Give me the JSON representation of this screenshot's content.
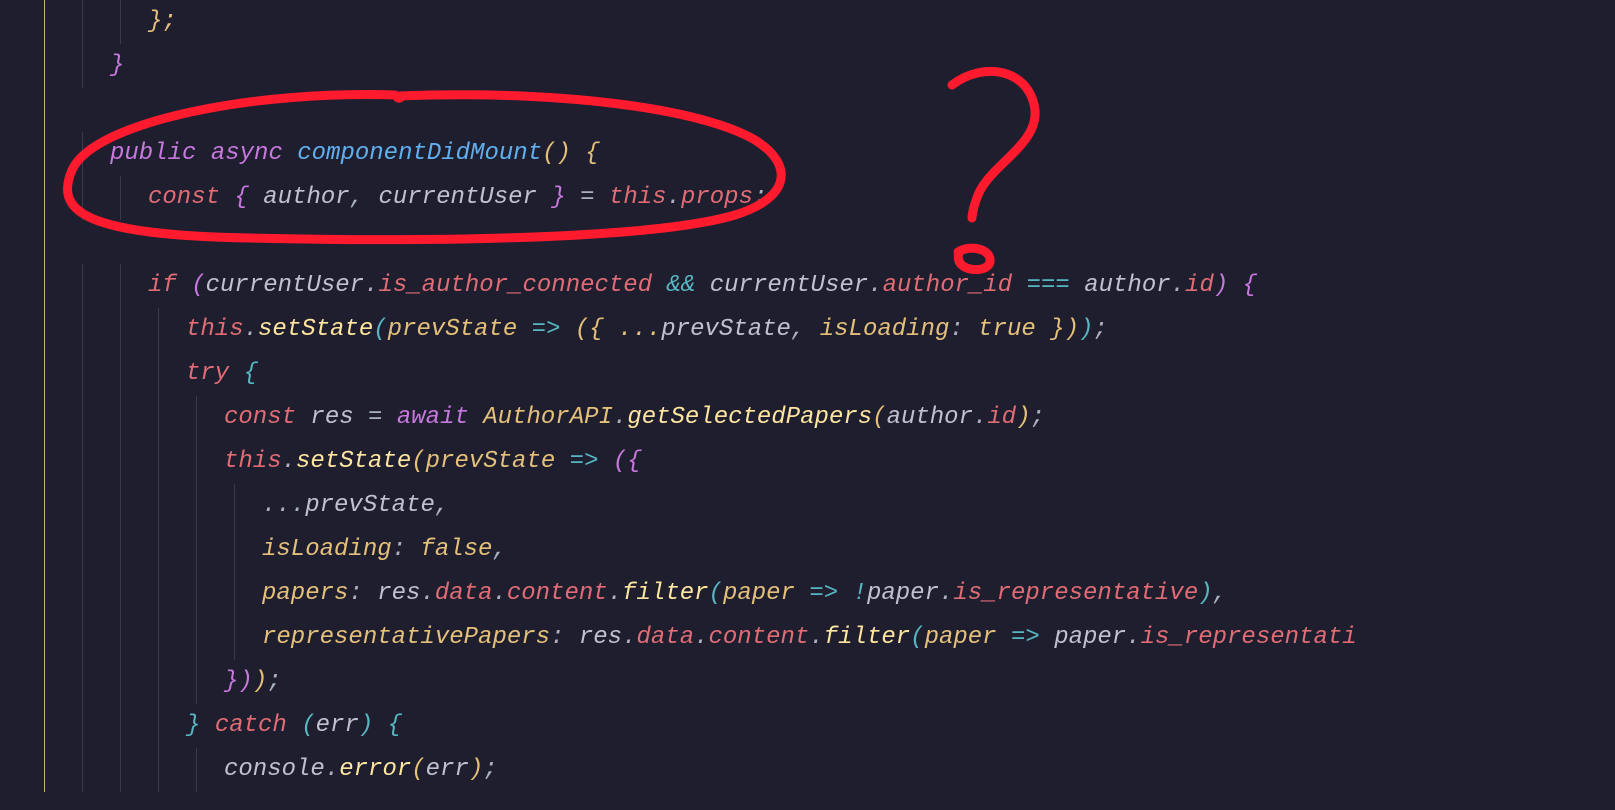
{
  "lines": [
    {
      "indent": 2,
      "tokens": [
        {
          "t": "};",
          "c": "brace-y"
        }
      ]
    },
    {
      "indent": 1,
      "tokens": [
        {
          "t": "}",
          "c": "brace-p"
        }
      ]
    },
    {
      "indent": 0,
      "tokens": []
    },
    {
      "indent": 1,
      "tokens": [
        {
          "t": "public ",
          "c": "kw-public"
        },
        {
          "t": "async ",
          "c": "kw-async"
        },
        {
          "t": "componentDidMount",
          "c": "fn"
        },
        {
          "t": "() {",
          "c": "brace-y"
        }
      ]
    },
    {
      "indent": 2,
      "tokens": [
        {
          "t": "const ",
          "c": "kw-const"
        },
        {
          "t": "{ ",
          "c": "brace-p"
        },
        {
          "t": "author",
          "c": "var"
        },
        {
          "t": ", ",
          "c": "punct"
        },
        {
          "t": "currentUser",
          "c": "var"
        },
        {
          "t": " } ",
          "c": "brace-p"
        },
        {
          "t": "= ",
          "c": "eq"
        },
        {
          "t": "this",
          "c": "kw-this"
        },
        {
          "t": ".",
          "c": "punct"
        },
        {
          "t": "props",
          "c": "prop2"
        },
        {
          "t": ";",
          "c": "punct"
        }
      ]
    },
    {
      "indent": 0,
      "tokens": []
    },
    {
      "indent": 2,
      "tokens": [
        {
          "t": "if ",
          "c": "kw-if"
        },
        {
          "t": "(",
          "c": "brace-p"
        },
        {
          "t": "currentUser",
          "c": "var"
        },
        {
          "t": ".",
          "c": "punct"
        },
        {
          "t": "is_author_connected",
          "c": "prop2"
        },
        {
          "t": " && ",
          "c": "op"
        },
        {
          "t": "currentUser",
          "c": "var"
        },
        {
          "t": ".",
          "c": "punct"
        },
        {
          "t": "author_id",
          "c": "prop2"
        },
        {
          "t": " === ",
          "c": "op"
        },
        {
          "t": "author",
          "c": "var"
        },
        {
          "t": ".",
          "c": "punct"
        },
        {
          "t": "id",
          "c": "prop2"
        },
        {
          "t": ") {",
          "c": "brace-p"
        }
      ]
    },
    {
      "indent": 3,
      "tokens": [
        {
          "t": "this",
          "c": "kw-this"
        },
        {
          "t": ".",
          "c": "punct"
        },
        {
          "t": "setState",
          "c": "method"
        },
        {
          "t": "(",
          "c": "brace-b"
        },
        {
          "t": "prevState",
          "c": "param"
        },
        {
          "t": " => ",
          "c": "op"
        },
        {
          "t": "({ ...",
          "c": "brace-y"
        },
        {
          "t": "prevState",
          "c": "var"
        },
        {
          "t": ", ",
          "c": "punct"
        },
        {
          "t": "isLoading",
          "c": "param"
        },
        {
          "t": ": ",
          "c": "punct"
        },
        {
          "t": "true",
          "c": "kw-true"
        },
        {
          "t": " })",
          "c": "brace-y"
        },
        {
          "t": ")",
          "c": "brace-b"
        },
        {
          "t": ";",
          "c": "punct"
        }
      ]
    },
    {
      "indent": 3,
      "tokens": [
        {
          "t": "try ",
          "c": "kw-try"
        },
        {
          "t": "{",
          "c": "brace-b"
        }
      ]
    },
    {
      "indent": 4,
      "tokens": [
        {
          "t": "const ",
          "c": "kw-const"
        },
        {
          "t": "res",
          "c": "var"
        },
        {
          "t": " = ",
          "c": "eq"
        },
        {
          "t": "await ",
          "c": "kw-await"
        },
        {
          "t": "AuthorAPI",
          "c": "class-name"
        },
        {
          "t": ".",
          "c": "punct"
        },
        {
          "t": "getSelectedPapers",
          "c": "method"
        },
        {
          "t": "(",
          "c": "brace-y"
        },
        {
          "t": "author",
          "c": "var"
        },
        {
          "t": ".",
          "c": "punct"
        },
        {
          "t": "id",
          "c": "prop2"
        },
        {
          "t": ")",
          "c": "brace-y"
        },
        {
          "t": ";",
          "c": "punct"
        }
      ]
    },
    {
      "indent": 4,
      "tokens": [
        {
          "t": "this",
          "c": "kw-this"
        },
        {
          "t": ".",
          "c": "punct"
        },
        {
          "t": "setState",
          "c": "method"
        },
        {
          "t": "(",
          "c": "brace-y"
        },
        {
          "t": "prevState",
          "c": "param"
        },
        {
          "t": " => ",
          "c": "op"
        },
        {
          "t": "({",
          "c": "brace-p"
        }
      ]
    },
    {
      "indent": 5,
      "tokens": [
        {
          "t": "...",
          "c": "punct"
        },
        {
          "t": "prevState",
          "c": "var"
        },
        {
          "t": ",",
          "c": "punct"
        }
      ]
    },
    {
      "indent": 5,
      "tokens": [
        {
          "t": "isLoading",
          "c": "param"
        },
        {
          "t": ": ",
          "c": "punct"
        },
        {
          "t": "false",
          "c": "kw-false"
        },
        {
          "t": ",",
          "c": "punct"
        }
      ]
    },
    {
      "indent": 5,
      "tokens": [
        {
          "t": "papers",
          "c": "param"
        },
        {
          "t": ": ",
          "c": "punct"
        },
        {
          "t": "res",
          "c": "var"
        },
        {
          "t": ".",
          "c": "punct"
        },
        {
          "t": "data",
          "c": "prop2"
        },
        {
          "t": ".",
          "c": "punct"
        },
        {
          "t": "content",
          "c": "prop2"
        },
        {
          "t": ".",
          "c": "punct"
        },
        {
          "t": "filter",
          "c": "method"
        },
        {
          "t": "(",
          "c": "brace-b"
        },
        {
          "t": "paper",
          "c": "param"
        },
        {
          "t": " => ",
          "c": "op"
        },
        {
          "t": "!",
          "c": "op"
        },
        {
          "t": "paper",
          "c": "var"
        },
        {
          "t": ".",
          "c": "punct"
        },
        {
          "t": "is_representative",
          "c": "prop2"
        },
        {
          "t": ")",
          "c": "brace-b"
        },
        {
          "t": ",",
          "c": "punct"
        }
      ]
    },
    {
      "indent": 5,
      "tokens": [
        {
          "t": "representativePapers",
          "c": "param"
        },
        {
          "t": ": ",
          "c": "punct"
        },
        {
          "t": "res",
          "c": "var"
        },
        {
          "t": ".",
          "c": "punct"
        },
        {
          "t": "data",
          "c": "prop2"
        },
        {
          "t": ".",
          "c": "punct"
        },
        {
          "t": "content",
          "c": "prop2"
        },
        {
          "t": ".",
          "c": "punct"
        },
        {
          "t": "filter",
          "c": "method"
        },
        {
          "t": "(",
          "c": "brace-b"
        },
        {
          "t": "paper",
          "c": "param"
        },
        {
          "t": " => ",
          "c": "op"
        },
        {
          "t": "paper",
          "c": "var"
        },
        {
          "t": ".",
          "c": "punct"
        },
        {
          "t": "is_representati",
          "c": "prop2"
        }
      ]
    },
    {
      "indent": 4,
      "tokens": [
        {
          "t": "})",
          "c": "brace-p"
        },
        {
          "t": ")",
          "c": "brace-y"
        },
        {
          "t": ";",
          "c": "punct"
        }
      ]
    },
    {
      "indent": 3,
      "tokens": [
        {
          "t": "} ",
          "c": "brace-b"
        },
        {
          "t": "catch ",
          "c": "kw-catch"
        },
        {
          "t": "(",
          "c": "brace-b"
        },
        {
          "t": "err",
          "c": "var"
        },
        {
          "t": ") {",
          "c": "brace-b"
        }
      ]
    },
    {
      "indent": 4,
      "tokens": [
        {
          "t": "console",
          "c": "var"
        },
        {
          "t": ".",
          "c": "punct"
        },
        {
          "t": "error",
          "c": "method"
        },
        {
          "t": "(",
          "c": "brace-y"
        },
        {
          "t": "err",
          "c": "var"
        },
        {
          "t": ")",
          "c": "brace-y"
        },
        {
          "t": ";",
          "c": "punct"
        }
      ]
    }
  ],
  "annotation": {
    "circle_label": "hand-drawn-circle",
    "question_mark_label": "hand-drawn-question-mark"
  }
}
